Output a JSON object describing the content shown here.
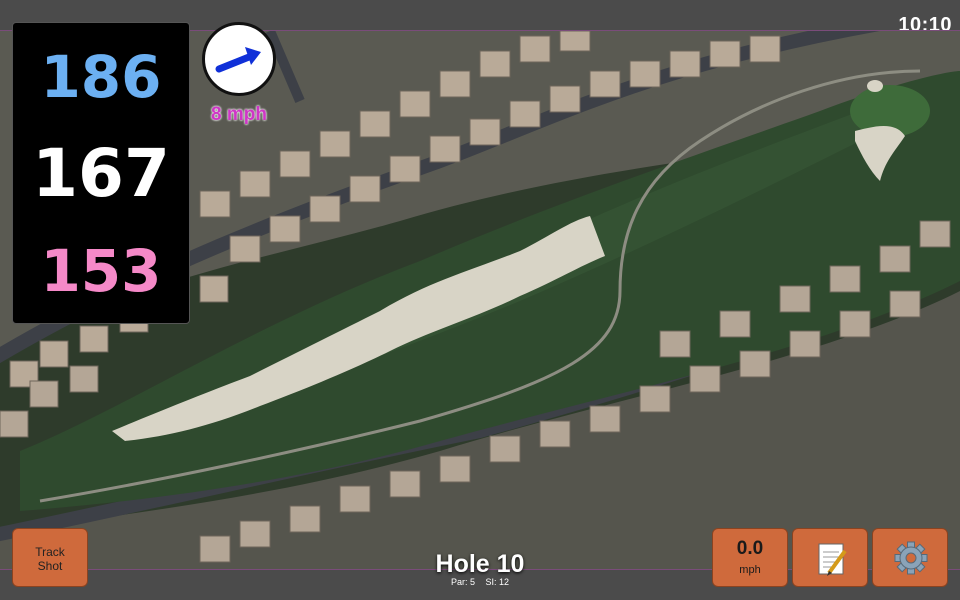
{
  "status": {
    "time": "10:10"
  },
  "yardage": {
    "back": "186",
    "middle": "167",
    "front": "153"
  },
  "wind": {
    "speed_text": "8 mph",
    "icon": "wind-direction-arrow-icon"
  },
  "hole": {
    "title": "Hole 10",
    "par": "Par: 5",
    "stroke_index": "SI: 12"
  },
  "buttons": {
    "track_shot": {
      "line1": "Track",
      "line2": "Shot"
    },
    "speed": {
      "value": "0.0",
      "unit": "mph"
    },
    "notes": {
      "icon": "notepad-icon"
    },
    "settings": {
      "icon": "gear-icon"
    }
  },
  "colors": {
    "back_yardage": "#6cb0f2",
    "middle_yardage": "#ffffff",
    "front_yardage": "#f589c8",
    "wind_text": "#cf36c6",
    "button": "#cf6a3c"
  }
}
